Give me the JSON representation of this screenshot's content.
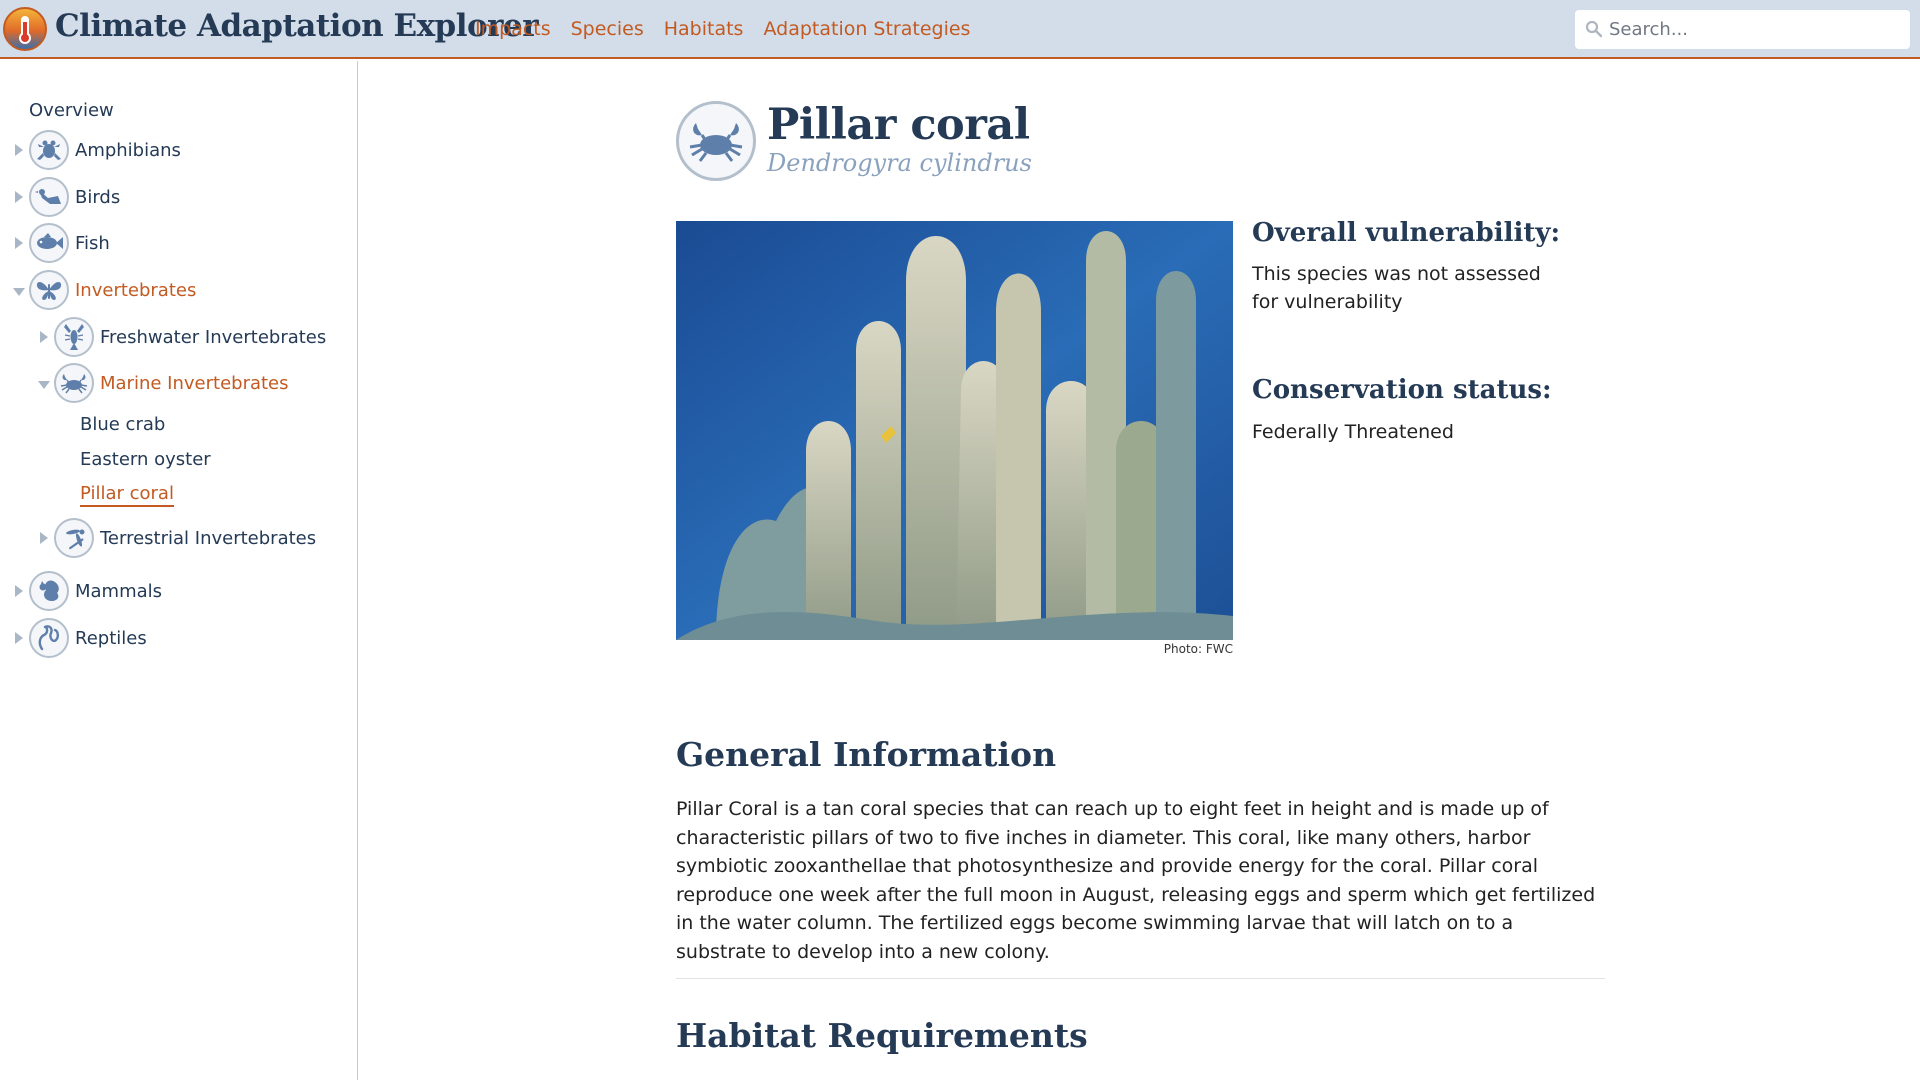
{
  "header": {
    "title": "Climate Adaptation Explorer",
    "nav": [
      "Impacts",
      "Species",
      "Habitats",
      "Adaptation Strategies"
    ],
    "search_placeholder": "Search...",
    "accent_color": "#c25a22",
    "background_color": "#d3dde9"
  },
  "sidebar": {
    "overview": "Overview",
    "groups": [
      {
        "label": "Amphibians",
        "icon": "frog-icon",
        "state": "collapsed"
      },
      {
        "label": "Birds",
        "icon": "bird-icon",
        "state": "collapsed"
      },
      {
        "label": "Fish",
        "icon": "fish-icon",
        "state": "collapsed"
      },
      {
        "label": "Invertebrates",
        "icon": "butterfly-icon",
        "state": "expanded"
      },
      {
        "label": "Mammals",
        "icon": "squirrel-icon",
        "state": "collapsed"
      },
      {
        "label": "Reptiles",
        "icon": "snake-icon",
        "state": "collapsed"
      }
    ],
    "subgroups": [
      {
        "label": "Freshwater Invertebrates",
        "icon": "crayfish-icon",
        "state": "collapsed"
      },
      {
        "label": "Marine Invertebrates",
        "icon": "crab-icon",
        "state": "expanded"
      },
      {
        "label": "Terrestrial Invertebrates",
        "icon": "dragonfly-icon",
        "state": "collapsed"
      }
    ],
    "species": [
      "Blue crab",
      "Eastern oyster",
      "Pillar coral"
    ],
    "current_species": "Pillar coral"
  },
  "species": {
    "icon": "crab-icon",
    "common_name": "Pillar coral",
    "scientific_name": "Dendrogyra cylindrus",
    "photo_credit": "Photo: FWC",
    "vulnerability_heading": "Overall vulnerability:",
    "vulnerability_text": "This species was not assessed for vulnerability",
    "conservation_heading": "Conservation status:",
    "conservation_text": "Federally Threatened"
  },
  "sections": {
    "general_heading": "General Information",
    "general_text": "Pillar Coral is a tan coral species that can reach up to eight feet in height and is made up of characteristic pillars of two to five inches in diameter. This coral, like many others, harbor symbiotic zooxanthellae that photosynthesize and provide energy for the coral. Pillar coral reproduce one week after the full moon in August, releasing eggs and sperm which get fertilized in the water column. The fertilized eggs become swimming larvae that will latch on to a substrate to develop into a new colony.",
    "habitat_heading": "Habitat Requirements"
  }
}
